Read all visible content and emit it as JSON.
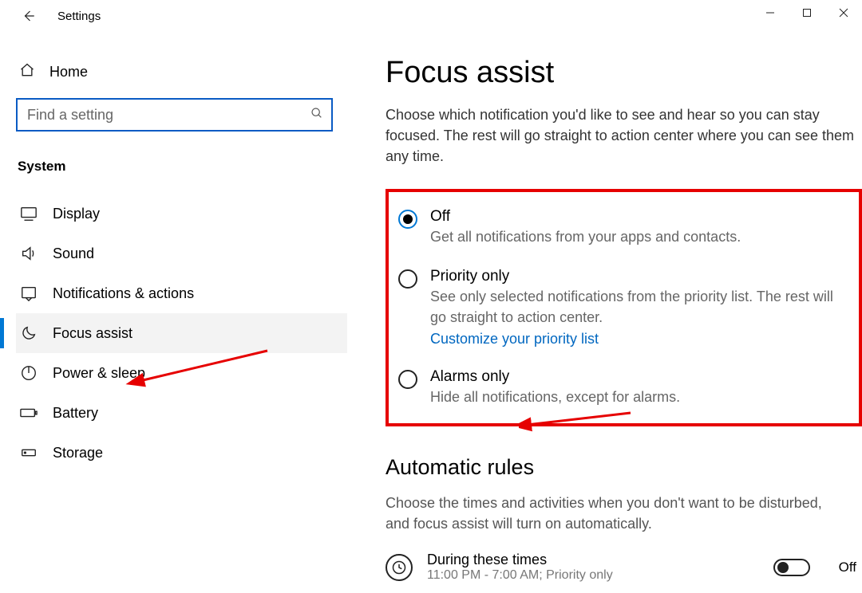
{
  "window": {
    "title": "Settings"
  },
  "sidebar": {
    "home_label": "Home",
    "search_placeholder": "Find a setting",
    "category": "System",
    "items": [
      {
        "label": "Display"
      },
      {
        "label": "Sound"
      },
      {
        "label": "Notifications & actions"
      },
      {
        "label": "Focus assist"
      },
      {
        "label": "Power & sleep"
      },
      {
        "label": "Battery"
      },
      {
        "label": "Storage"
      }
    ]
  },
  "main": {
    "heading": "Focus assist",
    "intro": "Choose which notification you'd like to see and hear so you can stay focused. The rest will go straight to action center where you can see them any time.",
    "radios": {
      "off": {
        "label": "Off",
        "desc": "Get all notifications from your apps and contacts."
      },
      "priority": {
        "label": "Priority only",
        "desc": "See only selected notifications from the priority list. The rest will go straight to action center.",
        "link": "Customize your priority list"
      },
      "alarms": {
        "label": "Alarms only",
        "desc": "Hide all notifications, except for alarms."
      }
    },
    "rules_heading": "Automatic rules",
    "rules_desc": "Choose the times and activities when you don't want to be disturbed, and focus assist will turn on automatically.",
    "rule1": {
      "title": "During these times",
      "sub": "11:00 PM - 7:00 AM; Priority only",
      "state": "Off"
    }
  }
}
